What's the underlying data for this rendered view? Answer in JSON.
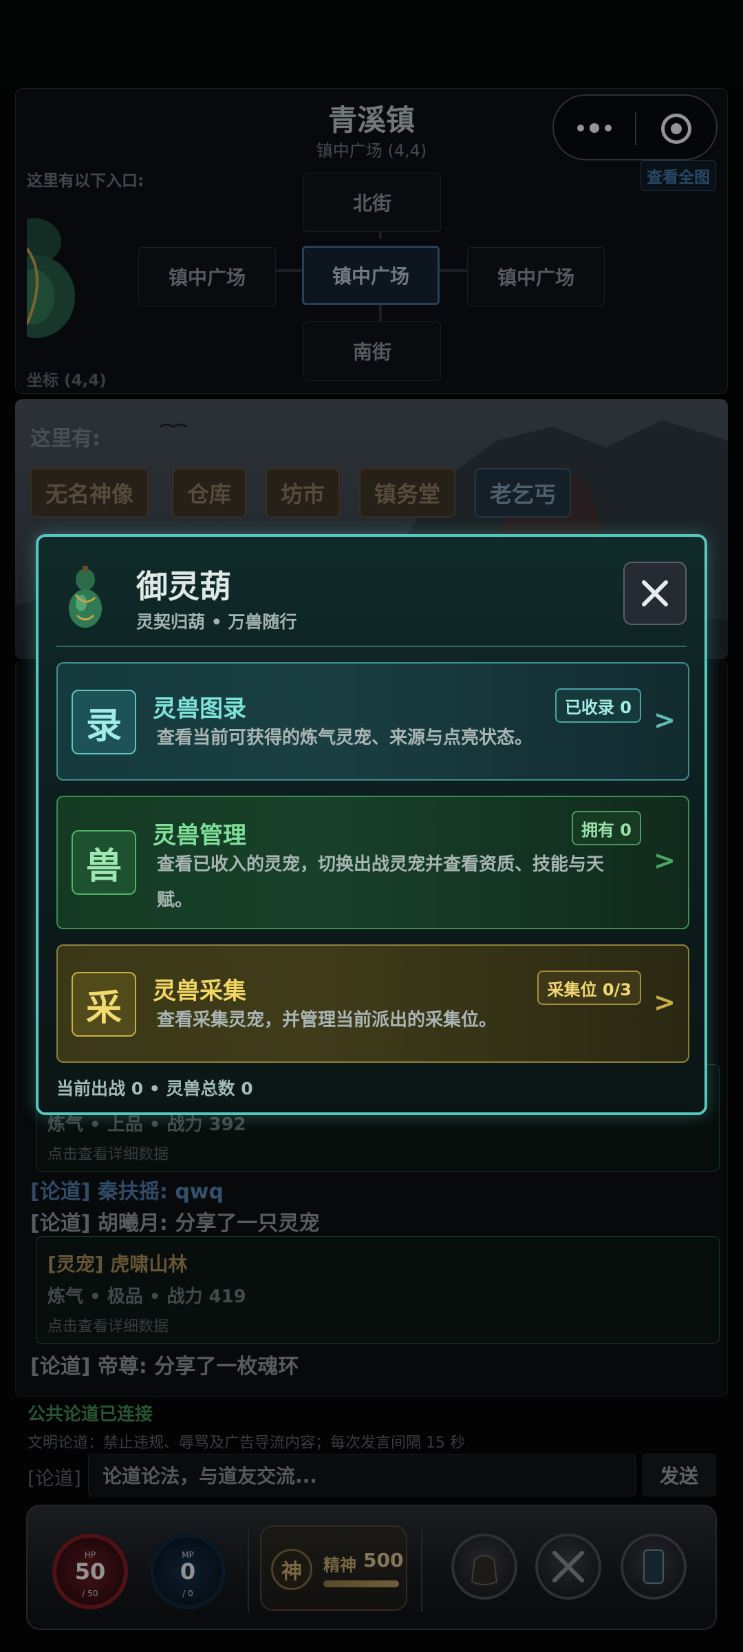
{
  "map": {
    "town_name": "青溪镇",
    "location": "镇中广场 (4,4)",
    "entrances_label": "这里有以下入口:",
    "view_all": "查看全图",
    "coord": "坐标 (4,4)",
    "nodes": {
      "north": "北街",
      "west": "镇中广场",
      "center": "镇中广场",
      "east": "镇中广场",
      "south": "南街"
    }
  },
  "scene": {
    "here_label": "这里有:",
    "tags": [
      "无名神像",
      "仓库",
      "坊市",
      "镇务堂",
      "老乞丐"
    ]
  },
  "chat": {
    "card1": {
      "stats": "炼气 • 上品 • 战力 392",
      "hint": "点击查看详细数据"
    },
    "line1": {
      "channel": "[论道]",
      "who": "秦扶摇:",
      "msg": "qwq"
    },
    "line2": {
      "channel": "[论道]",
      "who": "胡曦月:",
      "msg": "分享了一只灵宠"
    },
    "card2": {
      "title": "[灵宠] 虎啸山林",
      "stats": "炼气 • 极品 • 战力 419",
      "hint": "点击查看详细数据"
    },
    "line3": {
      "channel": "[论道]",
      "who": "帝尊:",
      "msg": "分享了一枚魂环"
    },
    "status": "公共论道已连接",
    "rule": "文明论道：禁止违规、辱骂及广告导流内容；每次发言间隔 15 秒",
    "prefix": "[论道]",
    "input_placeholder": "论道论法，与道友交流...",
    "send": "发送"
  },
  "hud": {
    "hp": {
      "label": "HP",
      "value": "50",
      "max": "/ 50"
    },
    "mp": {
      "label": "MP",
      "value": "0",
      "max": "/ 0"
    },
    "spirit": {
      "seal": "神",
      "label": "精神",
      "value": "500",
      "fill": 1.0
    }
  },
  "modal": {
    "title": "御灵葫",
    "subtitle": "灵契归葫 • 万兽随行",
    "entries": [
      {
        "char": "录",
        "title": "灵兽图录",
        "badge": "已收录 0",
        "desc": "查看当前可获得的炼气灵宠、来源与点亮状态。",
        "arrow": ">"
      },
      {
        "char": "兽",
        "title": "灵兽管理",
        "badge": "拥有 0",
        "desc": "查看已收入的灵宠，切换出战灵宠并查看资质、技能与天赋。",
        "arrow": ">"
      },
      {
        "char": "采",
        "title": "灵兽采集",
        "badge": "采集位 0/3",
        "desc": "查看采集灵宠，并管理当前派出的采集位。",
        "arrow": ">"
      }
    ],
    "footer": "当前出战 0 • 灵兽总数 0"
  },
  "colors": {
    "accent": "#55c7bf",
    "teal": "#7ee3d9",
    "green": "#7fe09a",
    "gold": "#f2d664"
  }
}
